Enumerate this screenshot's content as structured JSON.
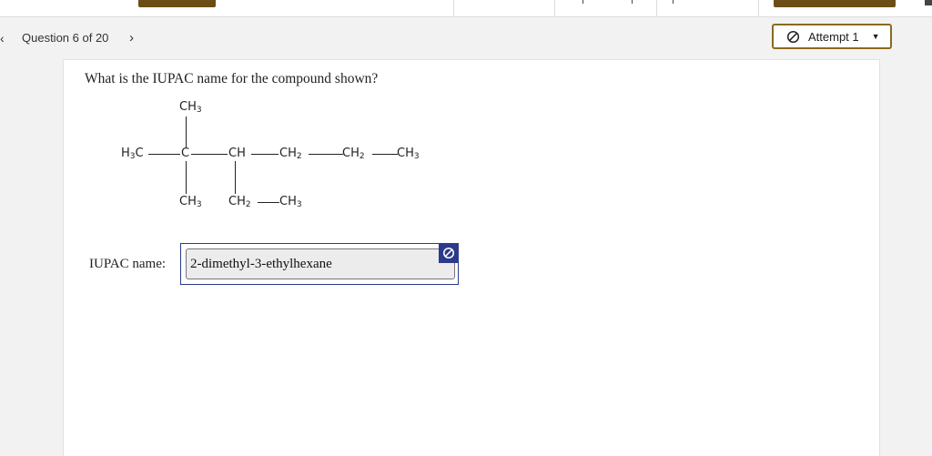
{
  "nav": {
    "prev_icon": "‹",
    "label": "Question 6 of 20",
    "next_icon": "›"
  },
  "attempt": {
    "label": "Attempt 1",
    "icon": "ban-icon",
    "caret": "▼"
  },
  "question": {
    "text": "What is the IUPAC name for the compound shown?"
  },
  "structure": {
    "top_ch3": "CH3",
    "h3c": "H3C",
    "c": "C",
    "ch": "CH",
    "ch2_a": "CH2",
    "ch2_b": "CH2",
    "ch3_end": "CH3",
    "ch3_bottom": "CH3",
    "ch2_bottom": "CH2",
    "ch3_ethyl": "CH3"
  },
  "answer": {
    "label": "IUPAC name:",
    "value": "2-dimethyl-3-ethylhexane",
    "status_icon": "ban-icon"
  },
  "colors": {
    "accent_brown": "#6b4e16",
    "answer_blue": "#2b3a8a",
    "text": "#222222"
  }
}
